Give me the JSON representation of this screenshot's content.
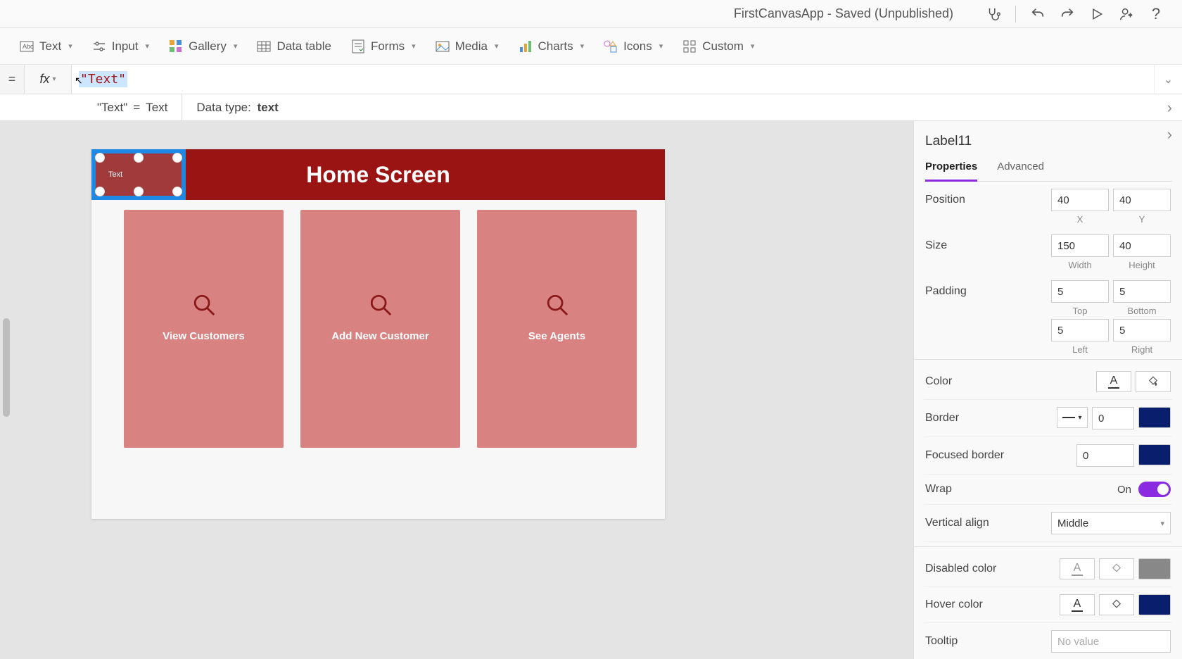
{
  "titlebar": {
    "title": "FirstCanvasApp - Saved (Unpublished)"
  },
  "ribbon": {
    "text": "Text",
    "input": "Input",
    "gallery": "Gallery",
    "datatable": "Data table",
    "forms": "Forms",
    "media": "Media",
    "charts": "Charts",
    "icons": "Icons",
    "custom": "Custom"
  },
  "formula": {
    "eq": "=",
    "fx": "fx",
    "value": "\"Text\"",
    "result_lhs": "\"Text\"",
    "result_eq": "=",
    "result_rhs": "Text",
    "datatype_label": "Data type:",
    "datatype_value": "text"
  },
  "canvas": {
    "header": "Home Screen",
    "selected_label_text": "Text",
    "cards": [
      {
        "caption": "View Customers"
      },
      {
        "caption": "Add New Customer"
      },
      {
        "caption": "See Agents"
      }
    ]
  },
  "props": {
    "control_name": "Label11",
    "tabs": {
      "properties": "Properties",
      "advanced": "Advanced"
    },
    "position": {
      "label": "Position",
      "x": "40",
      "y": "40",
      "xl": "X",
      "yl": "Y"
    },
    "size": {
      "label": "Size",
      "w": "150",
      "h": "40",
      "wl": "Width",
      "hl": "Height"
    },
    "padding": {
      "label": "Padding",
      "t": "5",
      "b": "5",
      "l": "5",
      "r": "5",
      "tl": "Top",
      "bl": "Bottom",
      "ll": "Left",
      "rl": "Right"
    },
    "color": {
      "label": "Color"
    },
    "border": {
      "label": "Border",
      "width": "0"
    },
    "focused_border": {
      "label": "Focused border",
      "width": "0"
    },
    "wrap": {
      "label": "Wrap",
      "state": "On"
    },
    "valign": {
      "label": "Vertical align",
      "value": "Middle"
    },
    "disabled_color": {
      "label": "Disabled color"
    },
    "hover_color": {
      "label": "Hover color"
    },
    "tooltip": {
      "label": "Tooltip",
      "placeholder": "No value"
    }
  }
}
